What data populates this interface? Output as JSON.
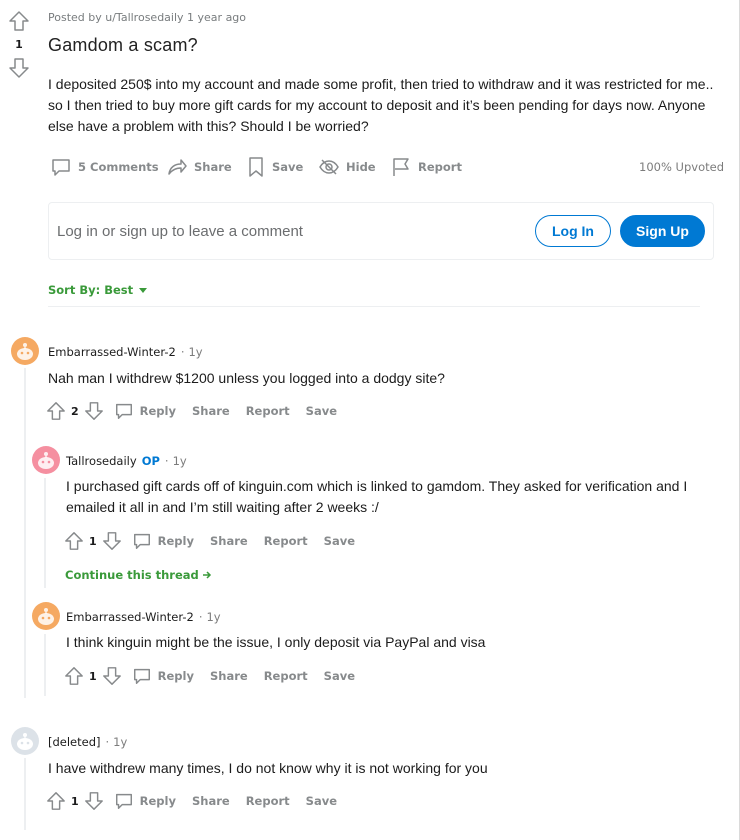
{
  "post": {
    "score": "1",
    "meta": "Posted by u/Tallrosedaily 1 year ago",
    "title": "Gamdom a scam?",
    "body": "I deposited 250$ into my account and made some profit, then tried to withdraw and it was restricted for me.. so I then tried to buy more gift cards for my account to deposit and it’s been pending for days now. Anyone else have a problem with this? Should I be worried?",
    "actions": {
      "comments": "5 Comments",
      "share": "Share",
      "save": "Save",
      "hide": "Hide",
      "report": "Report"
    },
    "upvoted": "100% Upvoted"
  },
  "comment_box": {
    "prompt": "Log in or sign up to leave a comment",
    "login": "Log In",
    "signup": "Sign Up"
  },
  "sort": {
    "label": "Sort By: Best"
  },
  "comments": [
    {
      "author": "Embarrassed-Winter-2",
      "op": "",
      "time": "1y",
      "body": "Nah man I withdrew $1200 unless you logged into a dodgy site?",
      "score": "2",
      "avatar_color": "#f5a962"
    },
    {
      "author": "Tallrosedaily",
      "op": "OP",
      "time": "1y",
      "body": "I purchased gift cards off of kinguin.com which is linked to gamdom. They asked for verification and I emailed it all in and I’m still waiting after 2 weeks :/",
      "score": "1",
      "avatar_color": "#f58fa0"
    },
    {
      "author": "Embarrassed-Winter-2",
      "op": "",
      "time": "1y",
      "body": "I think kinguin might be the issue, I only deposit via PayPal and visa",
      "score": "1",
      "avatar_color": "#f5a962"
    },
    {
      "author": "[deleted]",
      "op": "",
      "time": "1y",
      "body": "I have withdrew many times, I do not know why it is not working for you",
      "score": "1",
      "avatar_color": "#dce2e8"
    }
  ],
  "comment_actions": {
    "reply": "Reply",
    "share": "Share",
    "report": "Report",
    "save": "Save"
  },
  "continue_thread": "Continue this thread",
  "colors": {
    "accent": "#0079d3",
    "green": "#3a9a3a",
    "meta": "#878a8c"
  },
  "icons": [
    "upvote-icon",
    "downvote-icon",
    "comment-icon",
    "share-icon",
    "save-icon",
    "hide-icon",
    "report-icon",
    "reply-icon",
    "arrow-right-icon",
    "snoo-avatar-icon"
  ]
}
